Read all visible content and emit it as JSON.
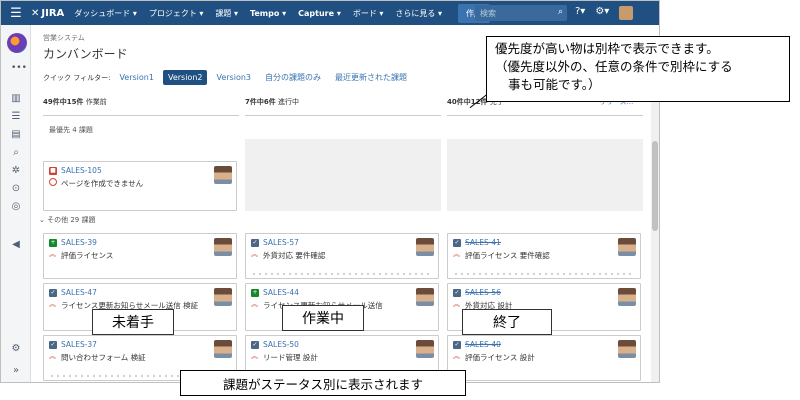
{
  "topnav": {
    "logo": "JIRA",
    "items": [
      "ダッシュボード ▾",
      "プロジェクト ▾",
      "課題 ▾",
      "Tempo ▾",
      "Capture ▾",
      "ボード ▾",
      "さらに見る ▾"
    ],
    "create_label": "作成",
    "search_placeholder": "検索",
    "help": "?▾",
    "settings": "⚙▾"
  },
  "board": {
    "breadcrumb": "営業システム",
    "title": "カンバンボード",
    "quick_filter_label": "クイック フィルター:",
    "filters": [
      "Version1",
      "Version2",
      "Version3",
      "自分の課題のみ",
      "最近更新された課題"
    ],
    "active_filter": "Version2"
  },
  "columns": [
    {
      "count": "49件中15件",
      "name": "作業前"
    },
    {
      "count": "7件中6件",
      "name": "進行中"
    },
    {
      "count": "40件中12件",
      "name": "完了"
    }
  ],
  "release_link": "リリース...",
  "swimlanes": {
    "top": {
      "name": "最優先",
      "count": "4 課題"
    },
    "other": {
      "name": "その他",
      "count": "29 課題"
    }
  },
  "cards": {
    "priority": {
      "key": "SALES-105",
      "summary": "ページを作成できません"
    },
    "todo": [
      {
        "key": "SALES-39",
        "summary": "評価ライセンス"
      },
      {
        "key": "SALES-47",
        "summary": "ライセンス更新お知らせメール送信 検証"
      },
      {
        "key": "SALES-37",
        "summary": "問い合わせフォーム 検証"
      }
    ],
    "progress": [
      {
        "key": "SALES-57",
        "summary": "外貨対応 要件確認"
      },
      {
        "key": "SALES-44",
        "summary": "ライセンス更新お知らせメール送信"
      },
      {
        "key": "SALES-50",
        "summary": "リード管理 設計"
      }
    ],
    "done": [
      {
        "key": "SALES-41",
        "summary": "評価ライセンス 要件確認"
      },
      {
        "key": "SALES-56",
        "summary": "外貨対応 設計"
      },
      {
        "key": "SALES-40",
        "summary": "評価ライセンス 設計"
      }
    ]
  },
  "annotations": {
    "todo": "未着手",
    "progress": "作業中",
    "done": "終了",
    "bottom": "課題がステータス別に表示されます",
    "top_line1": "優先度が高い物は別枠で表示できます。",
    "top_line2": "（優先度以外の、任意の条件で別枠にする",
    "top_line3": "事も可能です。）"
  },
  "colors": {
    "nav": "#205081",
    "active_filter": "#205081",
    "link": "#3b73af",
    "bug": "#d04437",
    "story": "#14892c",
    "task": "#4a6785"
  }
}
